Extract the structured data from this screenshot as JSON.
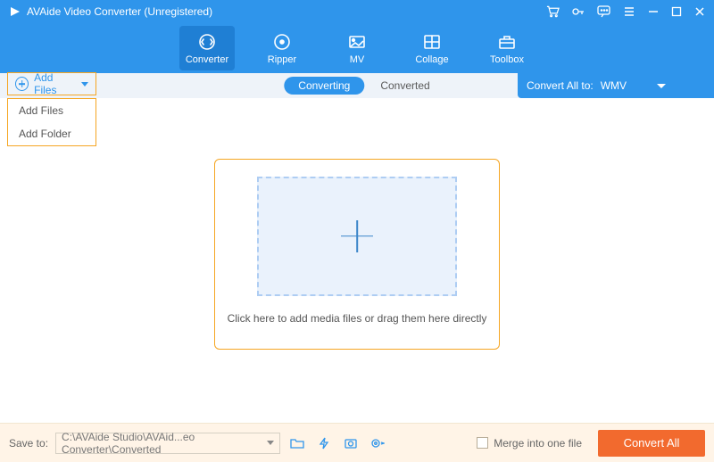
{
  "titlebar": {
    "title": "AVAide Video Converter (Unregistered)"
  },
  "nav": {
    "items": [
      {
        "label": "Converter"
      },
      {
        "label": "Ripper"
      },
      {
        "label": "MV"
      },
      {
        "label": "Collage"
      },
      {
        "label": "Toolbox"
      }
    ]
  },
  "add_files": {
    "button": "Add Files",
    "menu": [
      "Add Files",
      "Add Folder"
    ]
  },
  "tabs": {
    "converting": "Converting",
    "converted": "Converted"
  },
  "convert_all_to": {
    "label": "Convert All to:",
    "value": "WMV"
  },
  "drop": {
    "caption": "Click here to add media files or drag them here directly"
  },
  "footer": {
    "save_to_label": "Save to:",
    "path": "C:\\AVAide Studio\\AVAid...eo Converter\\Converted",
    "merge_label": "Merge into one file",
    "convert_all": "Convert All"
  }
}
